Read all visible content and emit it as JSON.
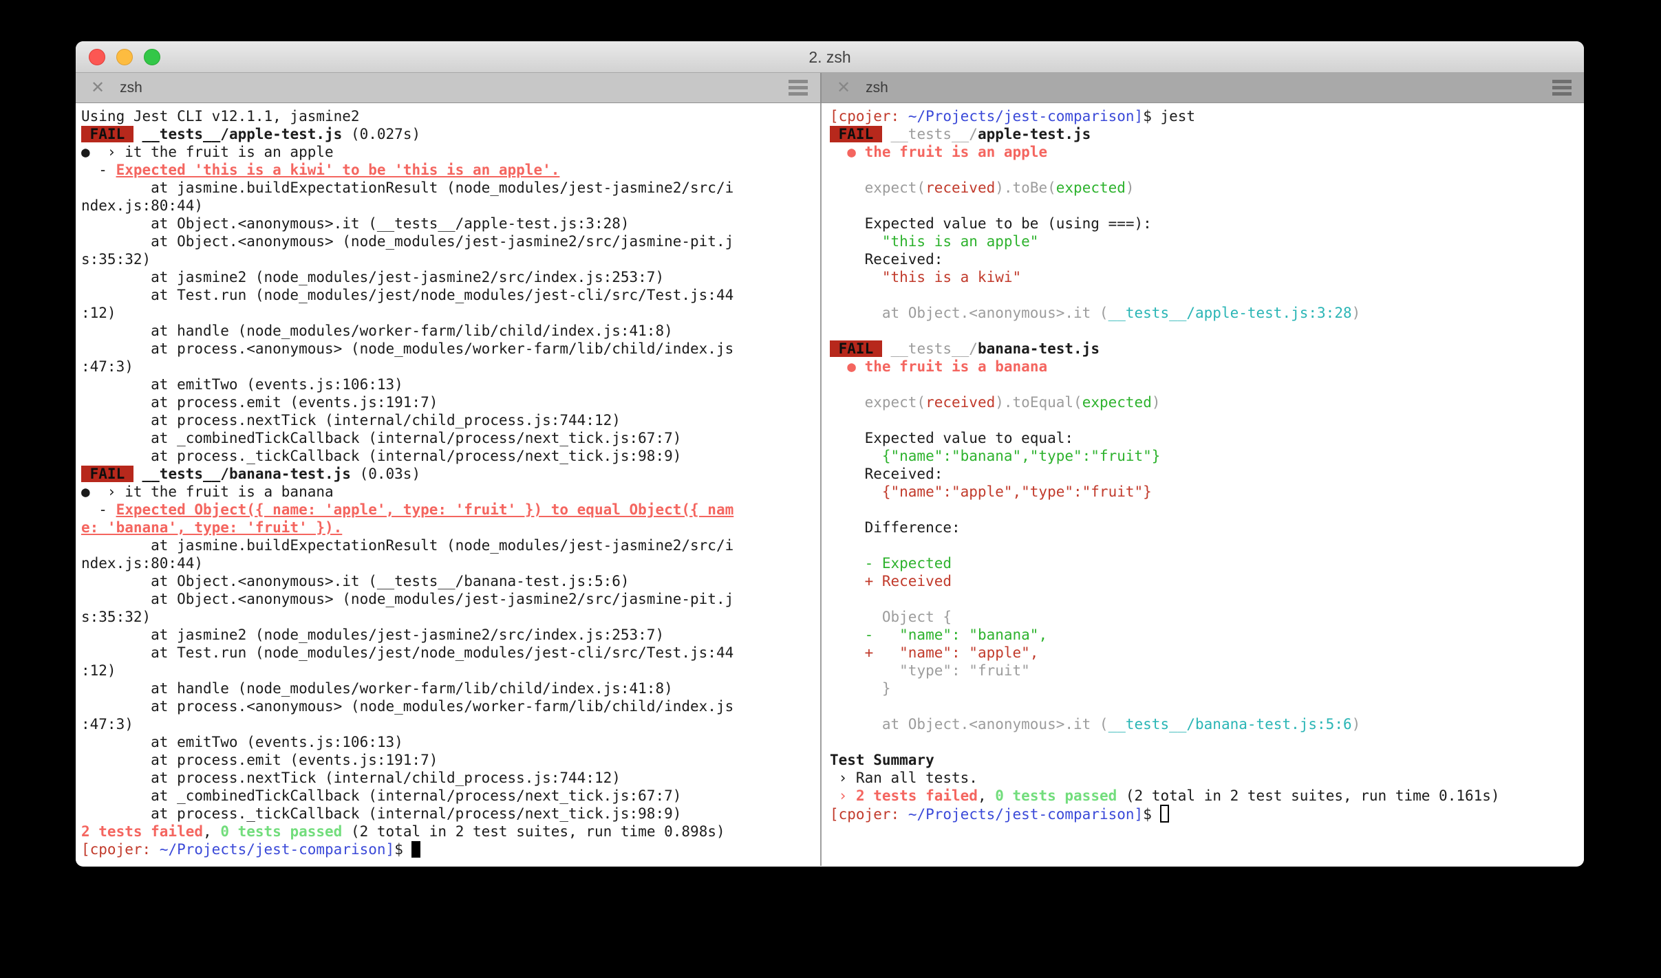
{
  "window": {
    "title": "2. zsh"
  },
  "colors": {
    "failBg": "#b7281c",
    "red": "#c13a2b",
    "salmon": "#f4655f",
    "green": "#2db22d",
    "brightGreen": "#72dd7c",
    "gray": "#9c9c9c",
    "cyan": "#2ab5b5",
    "blue": "#3a49d8",
    "text": "#1b1b1b"
  },
  "panes": [
    {
      "tab": {
        "close_label": "✕",
        "title": "zsh"
      },
      "active": true,
      "lines": [
        [
          {
            "t": "Using Jest CLI v12.1.1, jasmine2"
          }
        ],
        [
          {
            "t": " FAIL ",
            "c": "badge"
          },
          {
            "t": " "
          },
          {
            "t": "__tests__/apple-test.js",
            "f": "b"
          },
          {
            "t": " (0.027s)"
          }
        ],
        [
          {
            "t": "●  › it the fruit is an apple"
          }
        ],
        [
          {
            "t": "  - "
          },
          {
            "t": "Expected 'this is a kiwi' to be 'this is an apple'.",
            "c": "salmon",
            "f": "bu"
          }
        ],
        [
          {
            "t": "        at jasmine.buildExpectationResult (node_modules/jest-jasmine2/src/i"
          }
        ],
        [
          {
            "t": "ndex.js:80:44)"
          }
        ],
        [
          {
            "t": "        at Object.<anonymous>.it (__tests__/apple-test.js:3:28)"
          }
        ],
        [
          {
            "t": "        at Object.<anonymous> (node_modules/jest-jasmine2/src/jasmine-pit.j"
          }
        ],
        [
          {
            "t": "s:35:32)"
          }
        ],
        [
          {
            "t": "        at jasmine2 (node_modules/jest-jasmine2/src/index.js:253:7)"
          }
        ],
        [
          {
            "t": "        at Test.run (node_modules/jest/node_modules/jest-cli/src/Test.js:44"
          }
        ],
        [
          {
            "t": ":12)"
          }
        ],
        [
          {
            "t": "        at handle (node_modules/worker-farm/lib/child/index.js:41:8)"
          }
        ],
        [
          {
            "t": "        at process.<anonymous> (node_modules/worker-farm/lib/child/index.js"
          }
        ],
        [
          {
            "t": ":47:3)"
          }
        ],
        [
          {
            "t": "        at emitTwo (events.js:106:13)"
          }
        ],
        [
          {
            "t": "        at process.emit (events.js:191:7)"
          }
        ],
        [
          {
            "t": "        at process.nextTick (internal/child_process.js:744:12)"
          }
        ],
        [
          {
            "t": "        at _combinedTickCallback (internal/process/next_tick.js:67:7)"
          }
        ],
        [
          {
            "t": "        at process._tickCallback (internal/process/next_tick.js:98:9)"
          }
        ],
        [
          {
            "t": " FAIL ",
            "c": "badge"
          },
          {
            "t": " "
          },
          {
            "t": "__tests__/banana-test.js",
            "f": "b"
          },
          {
            "t": " (0.03s)"
          }
        ],
        [
          {
            "t": "●  › it the fruit is a banana"
          }
        ],
        [
          {
            "t": "  - "
          },
          {
            "t": "Expected Object({ name: 'apple', type: 'fruit' }) to equal Object({ nam",
            "c": "salmon",
            "f": "bu"
          }
        ],
        [
          {
            "t": "e: 'banana', type: 'fruit' }).",
            "c": "salmon",
            "f": "bu"
          }
        ],
        [
          {
            "t": "        at jasmine.buildExpectationResult (node_modules/jest-jasmine2/src/i"
          }
        ],
        [
          {
            "t": "ndex.js:80:44)"
          }
        ],
        [
          {
            "t": "        at Object.<anonymous>.it (__tests__/banana-test.js:5:6)"
          }
        ],
        [
          {
            "t": "        at Object.<anonymous> (node_modules/jest-jasmine2/src/jasmine-pit.j"
          }
        ],
        [
          {
            "t": "s:35:32)"
          }
        ],
        [
          {
            "t": "        at jasmine2 (node_modules/jest-jasmine2/src/index.js:253:7)"
          }
        ],
        [
          {
            "t": "        at Test.run (node_modules/jest/node_modules/jest-cli/src/Test.js:44"
          }
        ],
        [
          {
            "t": ":12)"
          }
        ],
        [
          {
            "t": "        at handle (node_modules/worker-farm/lib/child/index.js:41:8)"
          }
        ],
        [
          {
            "t": "        at process.<anonymous> (node_modules/worker-farm/lib/child/index.js"
          }
        ],
        [
          {
            "t": ":47:3)"
          }
        ],
        [
          {
            "t": "        at emitTwo (events.js:106:13)"
          }
        ],
        [
          {
            "t": "        at process.emit (events.js:191:7)"
          }
        ],
        [
          {
            "t": "        at process.nextTick (internal/child_process.js:744:12)"
          }
        ],
        [
          {
            "t": "        at _combinedTickCallback (internal/process/next_tick.js:67:7)"
          }
        ],
        [
          {
            "t": "        at process._tickCallback (internal/process/next_tick.js:98:9)"
          }
        ],
        [
          {
            "t": "2 tests failed",
            "c": "salmon",
            "f": "b"
          },
          {
            "t": ", "
          },
          {
            "t": "0 tests passed",
            "c": "brightGreen",
            "f": "b"
          },
          {
            "t": " (2 total in 2 test suites, run time 0.898s)"
          }
        ],
        [
          {
            "t": "[cpojer:",
            "c": "red"
          },
          {
            "t": " "
          },
          {
            "t": "~/Projects/jest-comparison]",
            "c": "blue"
          },
          {
            "t": "$ "
          },
          {
            "cursor": "solid"
          }
        ]
      ]
    },
    {
      "tab": {
        "close_label": "✕",
        "title": "zsh"
      },
      "active": false,
      "lines": [
        [
          {
            "t": "[cpojer:",
            "c": "red"
          },
          {
            "t": " "
          },
          {
            "t": "~/Projects/jest-comparison]",
            "c": "blue"
          },
          {
            "t": "$ jest"
          }
        ],
        [
          {
            "t": " FAIL ",
            "c": "badge"
          },
          {
            "t": " "
          },
          {
            "t": "__tests__/",
            "c": "gray"
          },
          {
            "t": "apple-test.js",
            "f": "b"
          }
        ],
        [
          {
            "t": "  "
          },
          {
            "t": "●",
            "c": "salmon"
          },
          {
            "t": " "
          },
          {
            "t": "the fruit is an apple",
            "c": "salmon",
            "f": "b"
          }
        ],
        [
          {
            "t": ""
          }
        ],
        [
          {
            "t": "    "
          },
          {
            "t": "expect(",
            "c": "gray"
          },
          {
            "t": "received",
            "c": "red"
          },
          {
            "t": ").toBe(",
            "c": "gray"
          },
          {
            "t": "expected",
            "c": "green"
          },
          {
            "t": ")",
            "c": "gray"
          }
        ],
        [
          {
            "t": ""
          }
        ],
        [
          {
            "t": "    Expected value to be (using ===):"
          }
        ],
        [
          {
            "t": "      "
          },
          {
            "t": "\"this is an apple\"",
            "c": "green"
          }
        ],
        [
          {
            "t": "    Received:"
          }
        ],
        [
          {
            "t": "      "
          },
          {
            "t": "\"this is a kiwi\"",
            "c": "red"
          }
        ],
        [
          {
            "t": ""
          }
        ],
        [
          {
            "t": "      "
          },
          {
            "t": "at Object.<anonymous>.it (",
            "c": "gray"
          },
          {
            "t": "__tests__/apple-test.js:3:28",
            "c": "cyan"
          },
          {
            "t": ")",
            "c": "gray"
          }
        ],
        [
          {
            "t": ""
          }
        ],
        [
          {
            "t": " FAIL ",
            "c": "badge"
          },
          {
            "t": " "
          },
          {
            "t": "__tests__/",
            "c": "gray"
          },
          {
            "t": "banana-test.js",
            "f": "b"
          }
        ],
        [
          {
            "t": "  "
          },
          {
            "t": "●",
            "c": "salmon"
          },
          {
            "t": " "
          },
          {
            "t": "the fruit is a banana",
            "c": "salmon",
            "f": "b"
          }
        ],
        [
          {
            "t": ""
          }
        ],
        [
          {
            "t": "    "
          },
          {
            "t": "expect(",
            "c": "gray"
          },
          {
            "t": "received",
            "c": "red"
          },
          {
            "t": ").toEqual(",
            "c": "gray"
          },
          {
            "t": "expected",
            "c": "green"
          },
          {
            "t": ")",
            "c": "gray"
          }
        ],
        [
          {
            "t": ""
          }
        ],
        [
          {
            "t": "    Expected value to equal:"
          }
        ],
        [
          {
            "t": "      "
          },
          {
            "t": "{\"name\":\"banana\",\"type\":\"fruit\"}",
            "c": "green"
          }
        ],
        [
          {
            "t": "    Received:"
          }
        ],
        [
          {
            "t": "      "
          },
          {
            "t": "{\"name\":\"apple\",\"type\":\"fruit\"}",
            "c": "red"
          }
        ],
        [
          {
            "t": ""
          }
        ],
        [
          {
            "t": "    Difference:"
          }
        ],
        [
          {
            "t": ""
          }
        ],
        [
          {
            "t": "    "
          },
          {
            "t": "- Expected",
            "c": "green"
          }
        ],
        [
          {
            "t": "    "
          },
          {
            "t": "+ Received",
            "c": "red"
          }
        ],
        [
          {
            "t": ""
          }
        ],
        [
          {
            "t": "      "
          },
          {
            "t": "Object {",
            "c": "gray"
          }
        ],
        [
          {
            "t": "    "
          },
          {
            "t": "-   \"name\": \"banana\",",
            "c": "green"
          }
        ],
        [
          {
            "t": "    "
          },
          {
            "t": "+   \"name\": \"apple\",",
            "c": "red"
          }
        ],
        [
          {
            "t": "        "
          },
          {
            "t": "\"type\": \"fruit\"",
            "c": "gray"
          }
        ],
        [
          {
            "t": "      "
          },
          {
            "t": "}",
            "c": "gray"
          }
        ],
        [
          {
            "t": ""
          }
        ],
        [
          {
            "t": "      "
          },
          {
            "t": "at Object.<anonymous>.it (",
            "c": "gray"
          },
          {
            "t": "__tests__/banana-test.js:5:6",
            "c": "cyan"
          },
          {
            "t": ")",
            "c": "gray"
          }
        ],
        [
          {
            "t": ""
          }
        ],
        [
          {
            "t": "Test Summary",
            "f": "b"
          }
        ],
        [
          {
            "t": " › Ran all tests."
          }
        ],
        [
          {
            "t": " › ",
            "c": "salmon"
          },
          {
            "t": "2 tests failed",
            "c": "salmon",
            "f": "b"
          },
          {
            "t": ", "
          },
          {
            "t": "0 tests passed",
            "c": "brightGreen",
            "f": "b"
          },
          {
            "t": " (2 total in 2 test suites, run time 0.161s)"
          }
        ],
        [
          {
            "t": "[cpojer:",
            "c": "red"
          },
          {
            "t": " "
          },
          {
            "t": "~/Projects/jest-comparison]",
            "c": "blue"
          },
          {
            "t": "$ "
          },
          {
            "cursor": "hollow"
          }
        ]
      ]
    }
  ]
}
